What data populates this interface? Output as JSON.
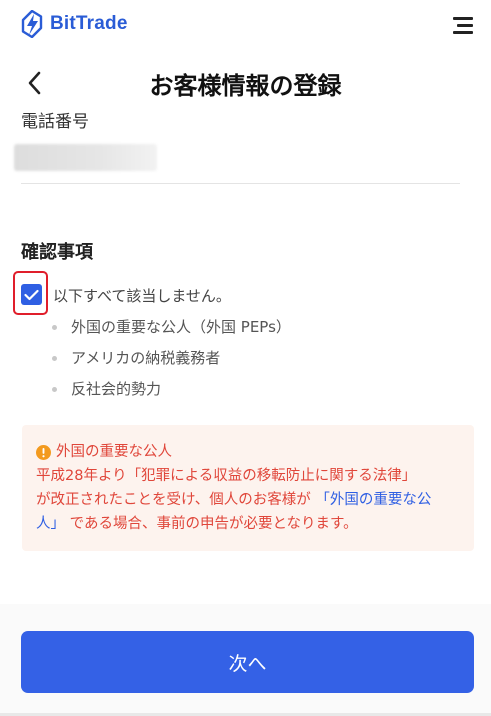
{
  "brand": {
    "name": "BitTrade",
    "color": "#2a5cd6"
  },
  "topbar": {
    "menu_icon": "menu-icon"
  },
  "header": {
    "title": "お客様情報の登録",
    "back_icon": "chevron-left-icon"
  },
  "form": {
    "phone": {
      "label": "電話番号",
      "value": ""
    }
  },
  "confirmation": {
    "title": "確認事項",
    "checkbox": {
      "checked": true,
      "label": "以下すべて該当しません。"
    },
    "items": [
      "外国の重要な公人（外国 PEPs）",
      "アメリカの納税義務者",
      "反社会的勢力"
    ]
  },
  "notice": {
    "icon": "alert-circle-icon",
    "title": "外国の重要な公人",
    "line1": "平成28年より「犯罪による収益の移転防止に関する法律」",
    "line2_before": "が改正されたことを受け、個人のお客様が",
    "link": "「外国の重要な公人」",
    "line3_after": "である場合、事前の申告が必要となります。",
    "color": "#e0463a",
    "link_color": "#2f5fe3"
  },
  "footer": {
    "next_label": "次へ",
    "button_color": "#3461e6"
  }
}
